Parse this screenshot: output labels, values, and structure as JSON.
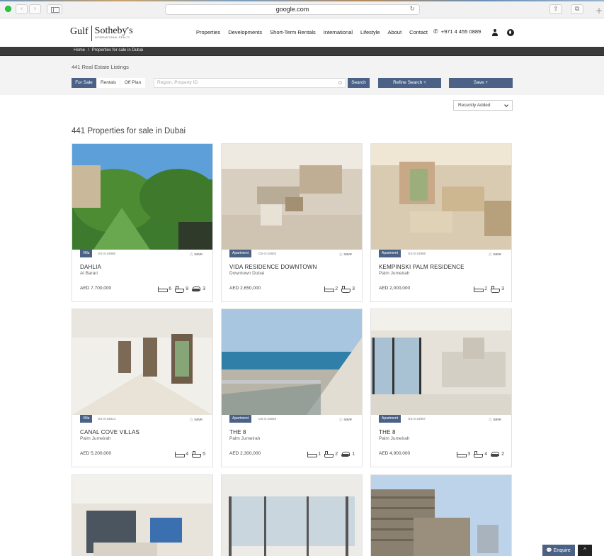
{
  "browser": {
    "url": "google.com",
    "back_icon": "chevron-left-icon",
    "forward_icon": "chevron-right-icon"
  },
  "header": {
    "logo_left": "Gulf",
    "logo_right": "Sotheby's",
    "logo_sub": "INTERNATIONAL REALTY",
    "nav": [
      "Properties",
      "Developments",
      "Short-Term Rentals",
      "International",
      "Lifestyle",
      "About",
      "Contact"
    ],
    "phone": "+971 4 455 0889"
  },
  "breadcrumb": {
    "home": "Home",
    "sep": "/",
    "current": "Properties for sale in Dubai"
  },
  "search": {
    "count_label": "441 Real Estate Listings",
    "tabs": [
      "For Sale",
      "Rentals",
      "Off Plan"
    ],
    "active_tab": "For Sale",
    "placeholder": "Region, Property ID",
    "search_button": "Search",
    "refine_button": "Refine Search",
    "save_button": "Save"
  },
  "sort": {
    "selected": "Recently Added"
  },
  "page_heading": "441 Properties for sale in Dubai",
  "save_label": "save",
  "listings": [
    {
      "type": "Villa",
      "id": "GS-S-24966",
      "title": "DAHLIA",
      "location": "Al Barari",
      "price": "AED 7,700,000",
      "beds": "6",
      "baths": "9",
      "parking": "3"
    },
    {
      "type": "Apartment",
      "id": "GS-S-24804",
      "title": "VIDA RESIDENCE DOWNTOWN",
      "location": "Downtown Dubai",
      "price": "AED 2,650,000",
      "beds": "2",
      "baths": "3",
      "parking": ""
    },
    {
      "type": "Apartment",
      "id": "GS-S-24965",
      "title": "KEMPINSKI PALM RESIDENCE",
      "location": "Palm Jumeirah",
      "price": "AED 2,000,000",
      "beds": "2",
      "baths": "3",
      "parking": ""
    },
    {
      "type": "Villa",
      "id": "GS-S-24814",
      "title": "CANAL COVE VILLAS",
      "location": "Palm Jumeirah",
      "price": "AED 5,200,000",
      "beds": "4",
      "baths": "5",
      "parking": ""
    },
    {
      "type": "Apartment",
      "id": "GS-S-23928",
      "title": "THE 8",
      "location": "Palm Jumeirah",
      "price": "AED 2,300,000",
      "beds": "1",
      "baths": "2",
      "parking": "1"
    },
    {
      "type": "Apartment",
      "id": "GS-S-23997",
      "title": "THE 8",
      "location": "Palm Jumeirah",
      "price": "AED 4,900,000",
      "beds": "3",
      "baths": "4",
      "parking": "2"
    }
  ],
  "floating": {
    "enquire": "Enquire",
    "to_top": "^"
  },
  "colors": {
    "accent": "#4b6186",
    "dark_bar": "#3a3a3a"
  }
}
